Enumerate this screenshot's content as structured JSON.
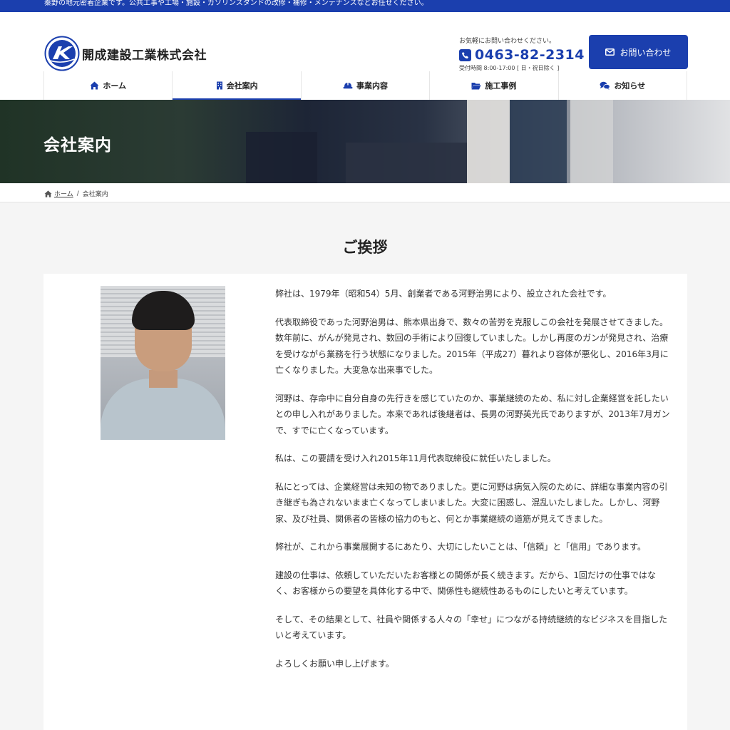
{
  "topbar": {
    "text": "秦野の地元密着企業です。公共工事や工場・施設・ガソリンスタンドの改修・補修・メンテナンスなどお任せください。"
  },
  "header": {
    "company_name": "開成建設工業株式会社",
    "contact_note": "お気軽にお問い合わせください。",
    "phone": "0463-82-2314",
    "hours": "受付時間 8:00-17:00 [ 日・祝日除く ]",
    "inquiry_label": "お問い合わせ"
  },
  "nav": {
    "items": [
      {
        "label": "ホーム",
        "icon": "home-icon"
      },
      {
        "label": "会社案内",
        "icon": "building-icon",
        "active": true
      },
      {
        "label": "事業内容",
        "icon": "helmet-icon"
      },
      {
        "label": "施工事例",
        "icon": "folder-icon"
      },
      {
        "label": "お知らせ",
        "icon": "comments-icon"
      }
    ]
  },
  "hero": {
    "title": "会社案内"
  },
  "breadcrumb": {
    "home": "ホーム",
    "current": "会社案内"
  },
  "section": {
    "title": "ご挨拶",
    "paragraphs": [
      "弊社は、1979年（昭和54）5月、創業者である河野治男により、設立された会社です。",
      "代表取締役であった河野治男は、熊本県出身で、数々の苦労を克服しこの会社を発展させてきました。数年前に、がんが発見され、数回の手術により回復していました。しかし再度のガンが発見され、治療を受けながら業務を行う状態になりました。2015年（平成27）暮れより容体が悪化し、2016年3月に亡くなりました。大変急な出来事でした。",
      "河野は、存命中に自分自身の先行きを感じていたのか、事業継続のため、私に対し企業経営を託したいとの申し入れがありました。本来であれば後継者は、長男の河野英光氏でありますが、2013年7月ガンで、すでに亡くなっています。",
      "私は、この要請を受け入れ2015年11月代表取締役に就任いたしました。",
      "私にとっては、企業経営は未知の物でありました。更に河野は病気入院のために、詳細な事業内容の引き継ぎも為されないまま亡くなってしまいました。大変に困惑し、混乱いたしました。しかし、河野家、及び社員、関係者の皆様の協力のもと、何とか事業継続の道筋が見えてきました。",
      "弊社が、これから事業展開するにあたり、大切にしたいことは、「信頼」と「信用」であります。",
      "建設の仕事は、依頼していただいたお客様との関係が長く続きます。だから、1回だけの仕事ではなく、お客様からの要望を具体化する中で、関係性も継続性あるものにしたいと考えています。",
      "そして、その結果として、社員や関係する人々の「幸せ」につながる持続継続的なビジネスを目指したいと考えています。",
      "よろしくお願い申し上げます。"
    ]
  },
  "colors": {
    "brand": "#1b3fae"
  }
}
